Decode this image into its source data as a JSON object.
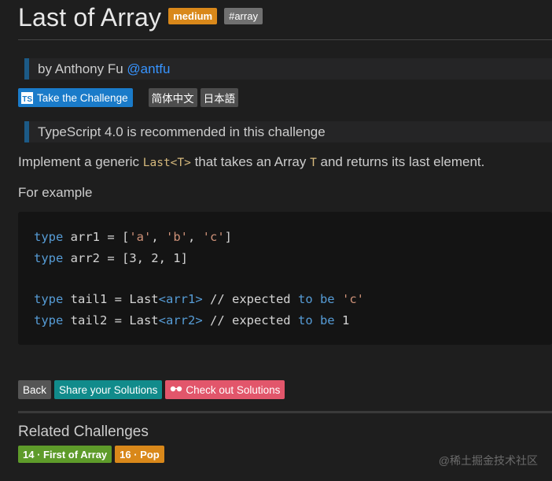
{
  "header": {
    "title": "Last of Array",
    "difficulty": "medium",
    "tag": "#array"
  },
  "author": {
    "prefix": "by Anthony Fu",
    "handle": "@antfu"
  },
  "chips": {
    "take_challenge": "Take the Challenge",
    "ts_logo": "TS",
    "lang_zh": "简体中文",
    "lang_ja": "日本語"
  },
  "note": "TypeScript 4.0 is recommended in this challenge",
  "description": {
    "before": "Implement a generic ",
    "code1": "Last<T>",
    "middle": " that takes an Array ",
    "code2": "T",
    "after": " and returns its last element."
  },
  "example_label": "For example",
  "code": {
    "line1": {
      "kw": "type",
      "name": " arr1 = [",
      "s1": "'a'",
      "c1": ", ",
      "s2": "'b'",
      "c2": ", ",
      "s3": "'c'",
      "end": "]"
    },
    "line2": {
      "kw": "type",
      "rest": " arr2 = [3, 2, 1]"
    },
    "line3": {
      "kw": "type",
      "name": " tail1 = Last",
      "gen": "<arr1>",
      "comment": " // expected ",
      "kw2": "to be",
      "sp": " ",
      "val": "'c'"
    },
    "line4": {
      "kw": "type",
      "name": " tail2 = Last",
      "gen": "<arr2>",
      "comment": " // expected ",
      "kw2": "to be",
      "sp": " ",
      "val": "1"
    }
  },
  "actions": {
    "back": "Back",
    "share": "Share your Solutions",
    "check": "Check out Solutions",
    "glasses_icon": "glasses-icon"
  },
  "related": {
    "title": "Related Challenges",
    "items": [
      {
        "label": "14 · First of Array",
        "difficulty": "easy"
      },
      {
        "label": "16 · Pop",
        "difficulty": "medium"
      }
    ]
  },
  "watermark": "@稀土掘金技术社区",
  "colors": {
    "background": "#1e1e1e",
    "medium": "#d9881a",
    "easy": "#5e9b2a",
    "share": "#118b8b",
    "check": "#e2566b",
    "take": "#1a7bc9",
    "quote_border": "#1c5a86"
  }
}
